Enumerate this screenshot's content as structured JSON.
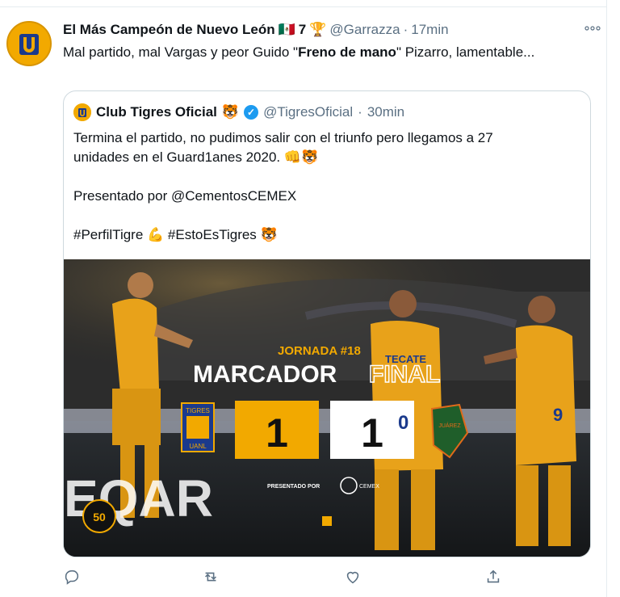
{
  "tweet": {
    "author_name": "El Más Campeón de Nuevo León",
    "author_flag": "🇲🇽",
    "author_suffix": "7",
    "author_trophy": "🏆",
    "handle": "@Garrazza",
    "separator": "·",
    "time": "17min",
    "text_before": "Mal partido, mal Vargas y peor Guido \"",
    "text_bold": "Freno de mano",
    "text_after": "\" Pizarro, lamentable..."
  },
  "quoted": {
    "author_name": "Club Tigres Oficial",
    "author_emoji": "🐯",
    "handle": "@TigresOficial",
    "separator": "·",
    "time": "30min",
    "line1": "Termina el partido, no pudimos salir con el triunfo pero llegamos a 27",
    "line2": "unidades en el Guard1anes 2020. 👊🐯",
    "line3": "Presentado por @CementosCEMEX",
    "line4": "#PerfilTigre 💪 #EstoEsTigres 🐯"
  },
  "graphic": {
    "jornada": "JORNADA #18",
    "title_left": "MARCADOR",
    "title_right": "FINAL",
    "home_score": "1",
    "away_score": "1",
    "home_badge": "TIGRES",
    "home_badge_sub": "UANL",
    "away_badge": "JUÁREZ",
    "sponsor_label": "PRESENTADO POR",
    "sponsor_name": "CEMEX",
    "jersey_text": "TECATE",
    "jersey_number_left": "0",
    "jersey_number_right": "9",
    "board_text": "EQAR",
    "badge_50": "50"
  },
  "colors": {
    "tigres_gold": "#f2a900",
    "verified_blue": "#1d9bf0",
    "muted_text": "#5b7083"
  },
  "actions": {
    "reply": "reply-icon",
    "retweet": "retweet-icon",
    "like": "like-icon",
    "share": "share-icon"
  }
}
